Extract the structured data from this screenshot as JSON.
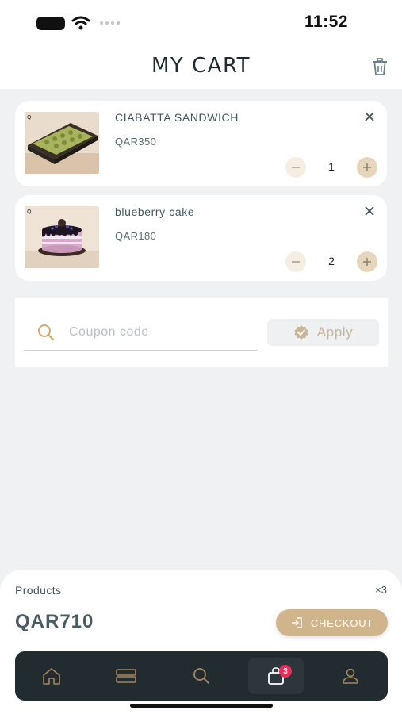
{
  "status_bar": {
    "time": "11:52"
  },
  "header": {
    "title": "MY CART",
    "trash_icon": "trash-icon"
  },
  "cart": {
    "items": [
      {
        "name": "CIABATTA SANDWICH",
        "price": "QAR350",
        "quantity": "1"
      },
      {
        "name": "blueberry cake",
        "price": "QAR180",
        "quantity": "2"
      }
    ]
  },
  "coupon": {
    "placeholder": "Coupon code",
    "apply_label": "Apply"
  },
  "summary": {
    "products_label": "Products",
    "products_count": "×3",
    "total": "QAR710",
    "checkout_label": "CHECKOUT"
  },
  "tabbar": {
    "tabs": [
      "home-icon",
      "categories-icon",
      "search-icon",
      "cart-icon",
      "profile-icon"
    ],
    "active": "cart-icon",
    "cart_badge": "3"
  },
  "colors": {
    "accent": "#cfb48c",
    "badge": "#e5305b",
    "tabbar": "#222b2f",
    "background": "#eff1f3"
  }
}
